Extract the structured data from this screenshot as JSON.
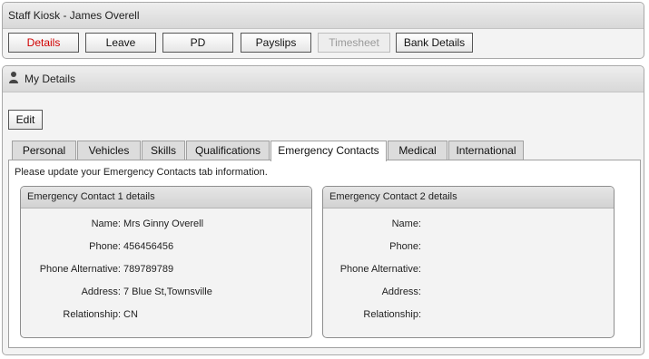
{
  "kiosk": {
    "title": "Staff Kiosk - James Overell",
    "buttons": {
      "details": "Details",
      "leave": "Leave",
      "pd": "PD",
      "payslips": "Payslips",
      "timesheet": "Timesheet",
      "bank_details": "Bank Details"
    },
    "active_button": "details",
    "disabled_button": "timesheet",
    "active_color": "#d00000"
  },
  "details_panel": {
    "title": "My Details",
    "icon": "user-icon",
    "edit_label": "Edit",
    "tabs": [
      "Personal",
      "Vehicles",
      "Skills",
      "Qualifications",
      "Emergency Contacts",
      "Medical",
      "International"
    ],
    "selected_tab": "Emergency Contacts",
    "info_text": "Please update your Emergency Contacts tab information."
  },
  "labels": {
    "name": "Name:",
    "phone": "Phone:",
    "phone_alt": "Phone Alternative:",
    "address": "Address:",
    "relationship": "Relationship:"
  },
  "contact1": {
    "title": "Emergency Contact 1 details",
    "name": "Mrs Ginny Overell",
    "phone": "456456456",
    "phone_alt": "789789789",
    "address": "7 Blue St,Townsville",
    "relationship": "CN"
  },
  "contact2": {
    "title": "Emergency Contact 2 details",
    "name": "",
    "phone": "",
    "phone_alt": "",
    "address": "",
    "relationship": ""
  },
  "value_color": "#1f3a8f"
}
